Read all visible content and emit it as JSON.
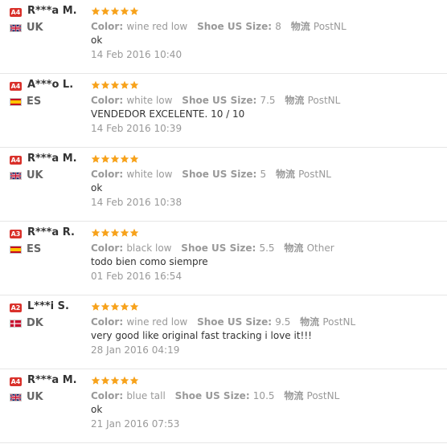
{
  "labels": {
    "color": "Color:",
    "size": "Shoe US Size:",
    "logistics": "物流"
  },
  "reviews": [
    {
      "badge": "A4",
      "name": "R***a M.",
      "country": "UK",
      "flag": "uk",
      "rating": 5,
      "color": "wine red low",
      "size": "8",
      "logistics": "PostNL",
      "comment": "ok",
      "date": "14 Feb 2016 10:40"
    },
    {
      "badge": "A4",
      "name": "A***o L.",
      "country": "ES",
      "flag": "es",
      "rating": 5,
      "color": "white low",
      "size": "7.5",
      "logistics": "PostNL",
      "comment": "VENDEDOR EXCELENTE. 10 / 10",
      "date": "14 Feb 2016 10:39"
    },
    {
      "badge": "A4",
      "name": "R***a M.",
      "country": "UK",
      "flag": "uk",
      "rating": 5,
      "color": "white low",
      "size": "5",
      "logistics": "PostNL",
      "comment": "ok",
      "date": "14 Feb 2016 10:38"
    },
    {
      "badge": "A3",
      "name": "R***a R.",
      "country": "ES",
      "flag": "es",
      "rating": 5,
      "color": "black low",
      "size": "5.5",
      "logistics": "Other",
      "comment": "todo bien como siempre",
      "date": "01 Feb 2016 16:54"
    },
    {
      "badge": "A2",
      "name": "L***i S.",
      "country": "DK",
      "flag": "dk",
      "rating": 5,
      "color": "wine red low",
      "size": "9.5",
      "logistics": "PostNL",
      "comment": "very good like original fast tracking i love it!!!",
      "date": "28 Jan 2016 04:19"
    },
    {
      "badge": "A4",
      "name": "R***a M.",
      "country": "UK",
      "flag": "uk",
      "rating": 5,
      "color": "blue tall",
      "size": "10.5",
      "logistics": "PostNL",
      "comment": "ok",
      "date": "21 Jan 2016 07:53"
    }
  ],
  "colors": {
    "star": "#f7a21b",
    "badge": "#d9312b",
    "muted": "#999999"
  }
}
